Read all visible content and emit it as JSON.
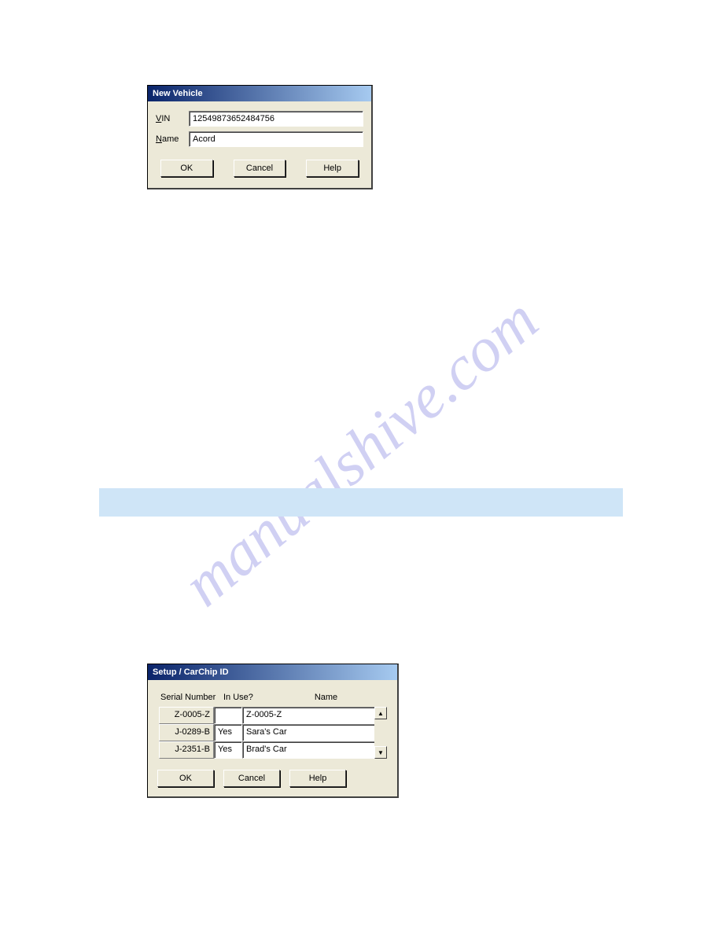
{
  "watermark": "manualshive.com",
  "dialog1": {
    "title": "New Vehicle",
    "vin_label_u": "V",
    "vin_label_rest": "IN",
    "vin_value": "12549873652484756",
    "name_label_u": "N",
    "name_label_rest": "ame",
    "name_value": "Acord",
    "ok": "OK",
    "cancel": "Cancel",
    "help": "Help"
  },
  "dialog2": {
    "title": "Setup / CarChip ID",
    "headers": {
      "serial": "Serial Number",
      "inuse": "In Use?",
      "name": "Name"
    },
    "rows": [
      {
        "serial": "Z-0005-Z",
        "inuse": "",
        "name": "Z-0005-Z"
      },
      {
        "serial": "J-0289-B",
        "inuse": "Yes",
        "name": "Sara's Car"
      },
      {
        "serial": "J-2351-B",
        "inuse": "Yes",
        "name": "Brad's Car"
      }
    ],
    "ok": "OK",
    "cancel": "Cancel",
    "help": "Help"
  }
}
